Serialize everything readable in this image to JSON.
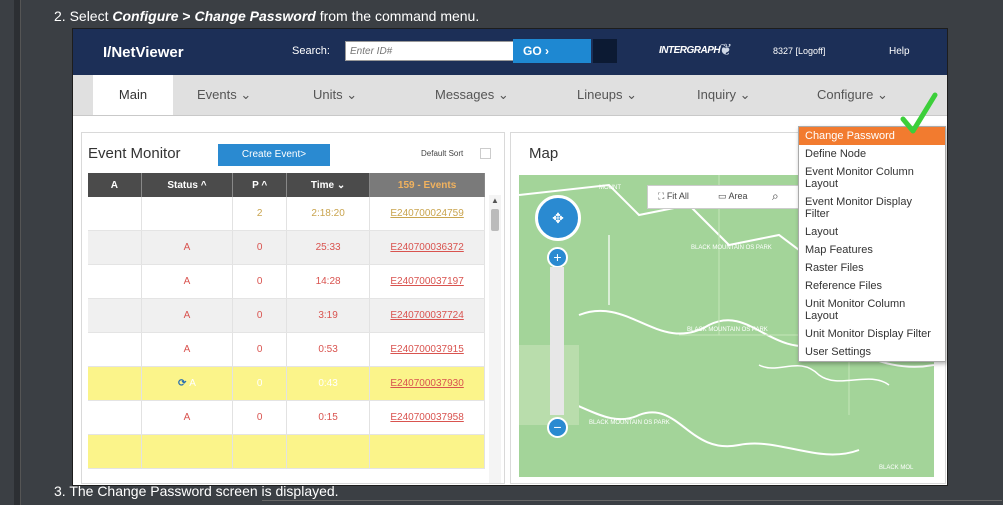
{
  "doc": {
    "step2": {
      "prefix": "2. Select ",
      "menu": "Configure",
      "sep": " > ",
      "item": "Change Password",
      "suffix": " from the command menu."
    },
    "step3": "3. The Change Password screen is displayed."
  },
  "app": {
    "brand": "I/NetViewer",
    "search_label": "Search:",
    "search_placeholder": "Enter ID#",
    "go_label": "GO ›",
    "logo_text": "INTERGRAPH",
    "user_text": "8327 [Logoff]",
    "help_label": "Help"
  },
  "nav": {
    "tabs": [
      "Main",
      "Events ⌄",
      "Units ⌄",
      "Messages ⌄",
      "Lineups ⌄",
      "Inquiry ⌄",
      "Configure ⌄"
    ]
  },
  "event_monitor": {
    "title": "Event Monitor",
    "create_label": "Create Event>",
    "default_sort": "Default Sort",
    "columns": [
      "A",
      "Status ^",
      "P ^",
      "Time ⌄",
      "159 - Events"
    ],
    "rows": [
      {
        "a": "",
        "status": "",
        "p": "2",
        "time": "2:18:20",
        "event": "E240700024759",
        "style": "white",
        "color": "gold"
      },
      {
        "a": "",
        "status": "A",
        "p": "0",
        "time": "25:33",
        "event": "E240700036372",
        "style": "grey",
        "color": "red"
      },
      {
        "a": "",
        "status": "A",
        "p": "0",
        "time": "14:28",
        "event": "E240700037197",
        "style": "white",
        "color": "red"
      },
      {
        "a": "",
        "status": "A",
        "p": "0",
        "time": "3:19",
        "event": "E240700037724",
        "style": "grey",
        "color": "red"
      },
      {
        "a": "",
        "status": "A",
        "p": "0",
        "time": "0:53",
        "event": "E240700037915",
        "style": "white",
        "color": "red"
      },
      {
        "a": "",
        "status": "A",
        "p": "0",
        "time": "0:43",
        "event": "E240700037930",
        "style": "yellow",
        "color": "black"
      },
      {
        "a": "",
        "status": "A",
        "p": "0",
        "time": "0:15",
        "event": "E240700037958",
        "style": "white",
        "color": "red"
      }
    ]
  },
  "map": {
    "title": "Map",
    "fit_all": "Fit All",
    "area": "Area",
    "labels": [
      "BLACK MOUNTAIN OS PARK",
      "BLACK MOUNTAIN OS PARK",
      "BLACK MOUNTAIN OS PARK",
      "BLACK MOU",
      "MOUNT",
      "BLACK MOUNTAIN OS PARK",
      "BLACK MOL"
    ]
  },
  "configure_menu": {
    "items": [
      "Change Password",
      "Define Node",
      "Event Monitor Column Layout",
      "Event Monitor Display Filter",
      "Layout",
      "Map Features",
      "Raster Files",
      "Reference Files",
      "Unit Monitor Column Layout",
      "Unit Monitor Display Filter",
      "User Settings"
    ],
    "selected_index": 0,
    "selected_color": "#f27b2f"
  },
  "colors": {
    "topbar": "#1c2f57",
    "accent": "#2a8ad1",
    "check": "#3ccf3a"
  }
}
